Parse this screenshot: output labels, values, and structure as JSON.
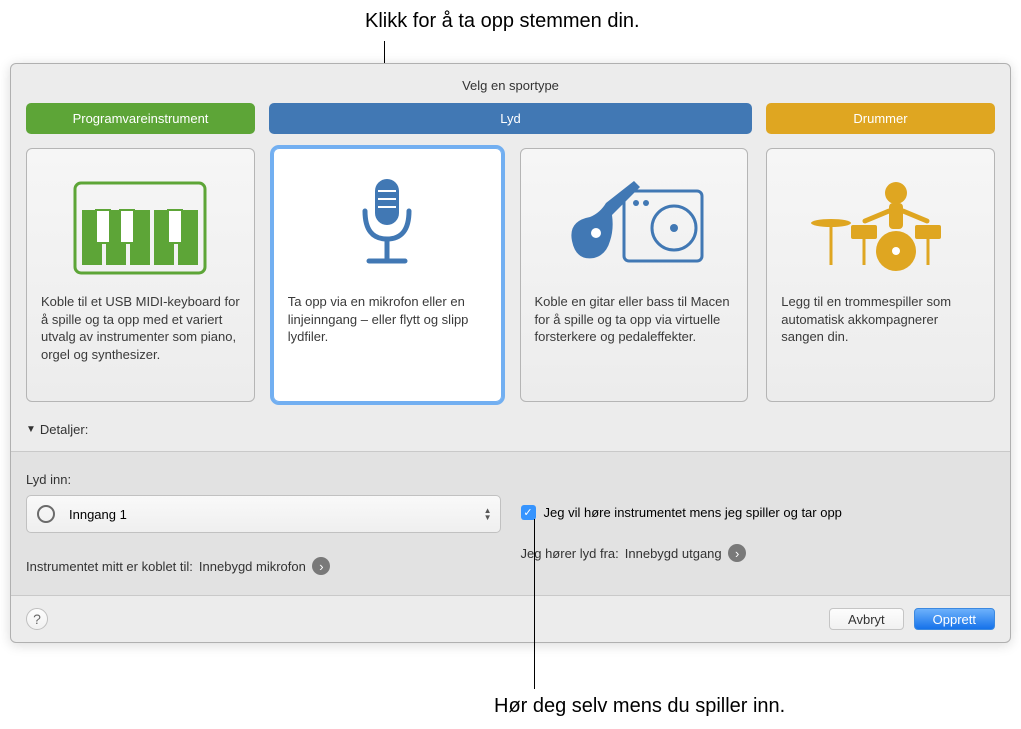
{
  "callouts": {
    "top": "Klikk for å ta opp stemmen din.",
    "bottom": "Hør deg selv mens du spiller inn."
  },
  "window": {
    "title": "Velg en sportype",
    "tabs": {
      "software": "Programvareinstrument",
      "audio": "Lyd",
      "drummer": "Drummer"
    },
    "cards": {
      "software": "Koble til et USB MIDI-keyboard for å spille og ta opp med et variert utvalg av instrumenter som piano, orgel og synthesizer.",
      "mic": "Ta opp via en mikrofon eller en linjeinngang – eller flytt og slipp lydfiler.",
      "guitar": "Koble en gitar eller bass til Macen for å spille og ta opp via virtuelle forsterkere og pedaleffekter.",
      "drummer": "Legg til en trommespiller som automatisk akkompagnerer sangen din."
    },
    "details_label": "Detaljer:",
    "input": {
      "label": "Lyd inn:",
      "value": "Inngang 1",
      "connected_prefix": "Instrumentet mitt er koblet til: ",
      "connected_value": "Innebygd mikrofon"
    },
    "monitor": {
      "checkbox_label": "Jeg vil høre instrumentet mens jeg spiller og tar opp",
      "output_prefix": "Jeg hører lyd fra: ",
      "output_value": "Innebygd utgang"
    },
    "buttons": {
      "help": "?",
      "cancel": "Avbryt",
      "create": "Opprett"
    }
  }
}
